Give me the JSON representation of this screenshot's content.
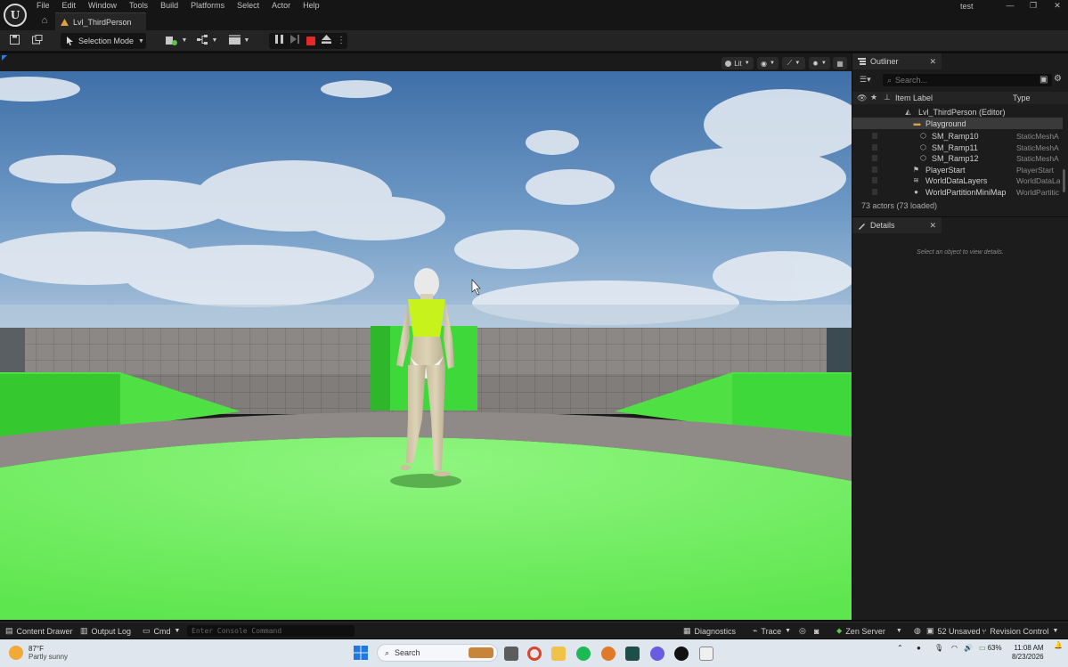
{
  "titlebar": {
    "logo_text": "U",
    "menu": [
      "File",
      "Edit",
      "Window",
      "Tools",
      "Build",
      "Platforms",
      "Select",
      "Actor",
      "Help"
    ],
    "level_tab": "Lvl_ThirdPerson",
    "project_name": "test",
    "window_controls": [
      "—",
      "❐",
      "✕"
    ]
  },
  "toolbar": {
    "mode_label": "Selection Mode"
  },
  "viewport": {
    "lit_label": "Lit",
    "icons": [
      "perspective-icon",
      "show-icon",
      "snapping-icon",
      "settings-icon",
      "layout-icon"
    ]
  },
  "outliner": {
    "tab_label": "Outliner",
    "search_placeholder": "Search...",
    "col_label": "Item Label",
    "col_type": "Type",
    "rows": [
      {
        "name": "Lvl_ThirdPerson (Editor)",
        "type": ""
      },
      {
        "name": "Playground",
        "type": ""
      },
      {
        "name": "SM_Ramp10",
        "type": "StaticMeshA"
      },
      {
        "name": "SM_Ramp11",
        "type": "StaticMeshA"
      },
      {
        "name": "SM_Ramp12",
        "type": "StaticMeshA"
      },
      {
        "name": "PlayerStart",
        "type": "PlayerStart"
      },
      {
        "name": "WorldDataLayers",
        "type": "WorldDataLa"
      },
      {
        "name": "WorldPartitionMiniMap",
        "type": "WorldPartitic"
      }
    ],
    "actors_count": "73 actors (73 loaded)"
  },
  "details": {
    "tab_label": "Details",
    "hint": "Select an object to view details."
  },
  "statusbar": {
    "content_drawer": "Content Drawer",
    "output_log": "Output Log",
    "cmd": "Cmd",
    "console_placeholder": "Enter Console Command",
    "diagnostics": "Diagnostics",
    "trace": "Trace",
    "zen_server": "Zen Server",
    "unsaved": "52 Unsaved",
    "revision_control": "Revision Control"
  },
  "taskbar": {
    "temperature": "87°F",
    "weather": "Partly sunny",
    "search": "Search",
    "battery": "63%",
    "time": "11:08 AM",
    "date": "8/23/2026"
  },
  "colors": {
    "accent_green": "#5fe852",
    "stop_red": "#e22a2a",
    "folder": "#d9a24a"
  }
}
